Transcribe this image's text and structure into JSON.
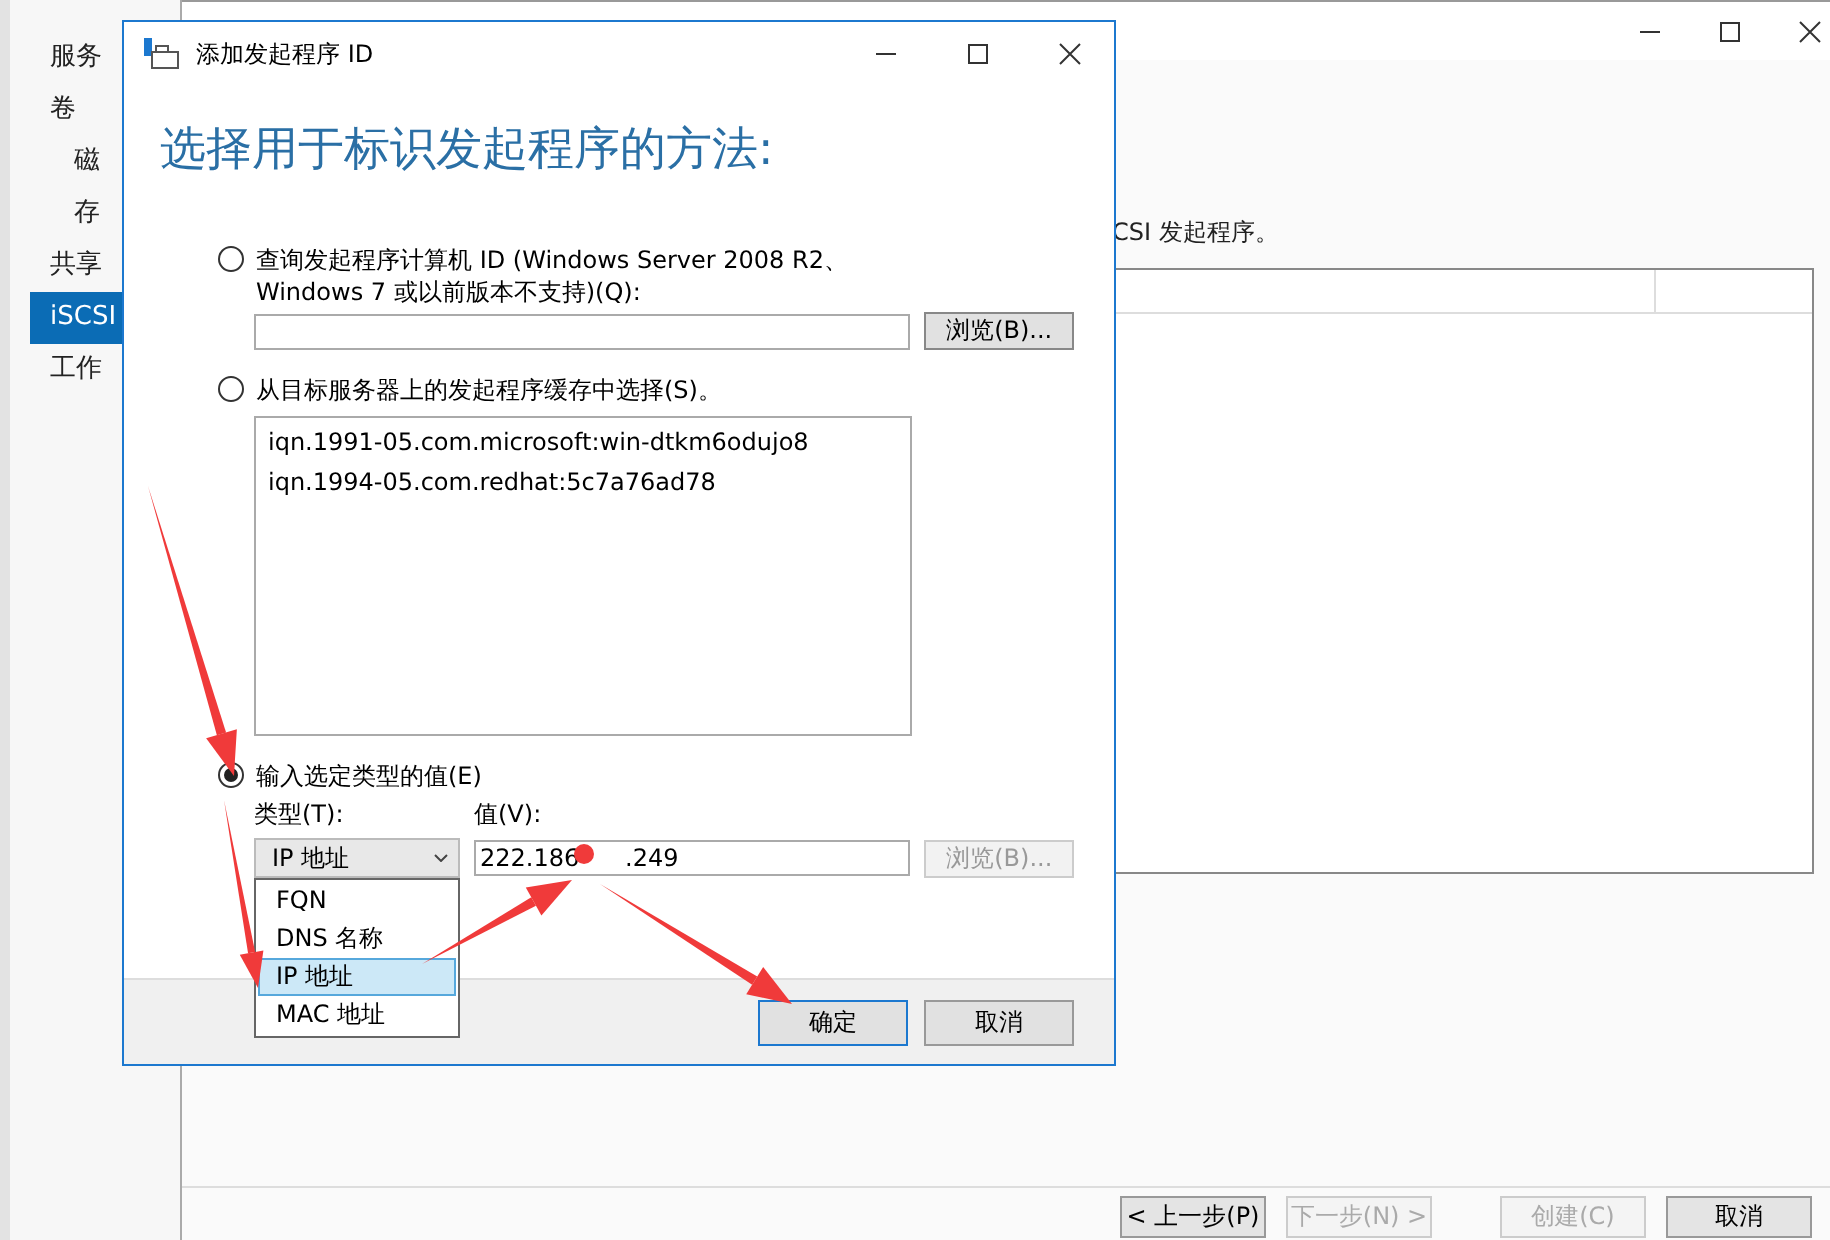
{
  "sidebar": {
    "items": [
      {
        "label": "服务",
        "selected": false
      },
      {
        "label": "卷",
        "selected": false,
        "children": [
          {
            "label": "磁",
            "selected": false
          },
          {
            "label": "存",
            "selected": false
          }
        ]
      },
      {
        "label": "共享",
        "selected": false
      },
      {
        "label": "iSCSI",
        "selected": true
      },
      {
        "label": "工作",
        "selected": false
      }
    ]
  },
  "wizard": {
    "description": "CSI 发起程序。",
    "buttons": [
      {
        "label": "< 上一步(P)",
        "disabled": false
      },
      {
        "label": "下一步(N) >",
        "disabled": true
      },
      {
        "label": "创建(C)",
        "disabled": true
      },
      {
        "label": "取消",
        "disabled": false
      }
    ]
  },
  "dialog": {
    "title": "添加发起程序 ID",
    "heading": "选择用于标识发起程序的方法:",
    "options": [
      {
        "kind": "query",
        "label": "查询发起程序计算机 ID (Windows Server 2008 R2、Windows 7 或以前版本不支持)(Q):",
        "selected": false,
        "browse": {
          "label": "浏览(B)...",
          "disabled": false
        }
      },
      {
        "kind": "cache",
        "label": "从目标服务器上的发起程序缓存中选择(S)。",
        "selected": false,
        "items": [
          "iqn.1991-05.com.microsoft:win-dtkm6odujo8",
          "iqn.1994-05.com.redhat:5c7a76ad78"
        ]
      },
      {
        "kind": "typed",
        "label": "输入选定类型的值(E)",
        "selected": true,
        "type_label": "类型(T):",
        "value_label": "值(V):",
        "type_value": "IP 地址",
        "value": "222.186      .249",
        "browse": {
          "label": "浏览(B)...",
          "disabled": true
        },
        "dropdown": [
          {
            "label": "FQN",
            "selected": false
          },
          {
            "label": "DNS 名称",
            "selected": false
          },
          {
            "label": "IP 地址",
            "selected": true
          },
          {
            "label": "MAC 地址",
            "selected": false
          }
        ]
      }
    ],
    "buttons": [
      {
        "label": "确定",
        "default": true
      },
      {
        "label": "取消",
        "default": false
      }
    ]
  }
}
